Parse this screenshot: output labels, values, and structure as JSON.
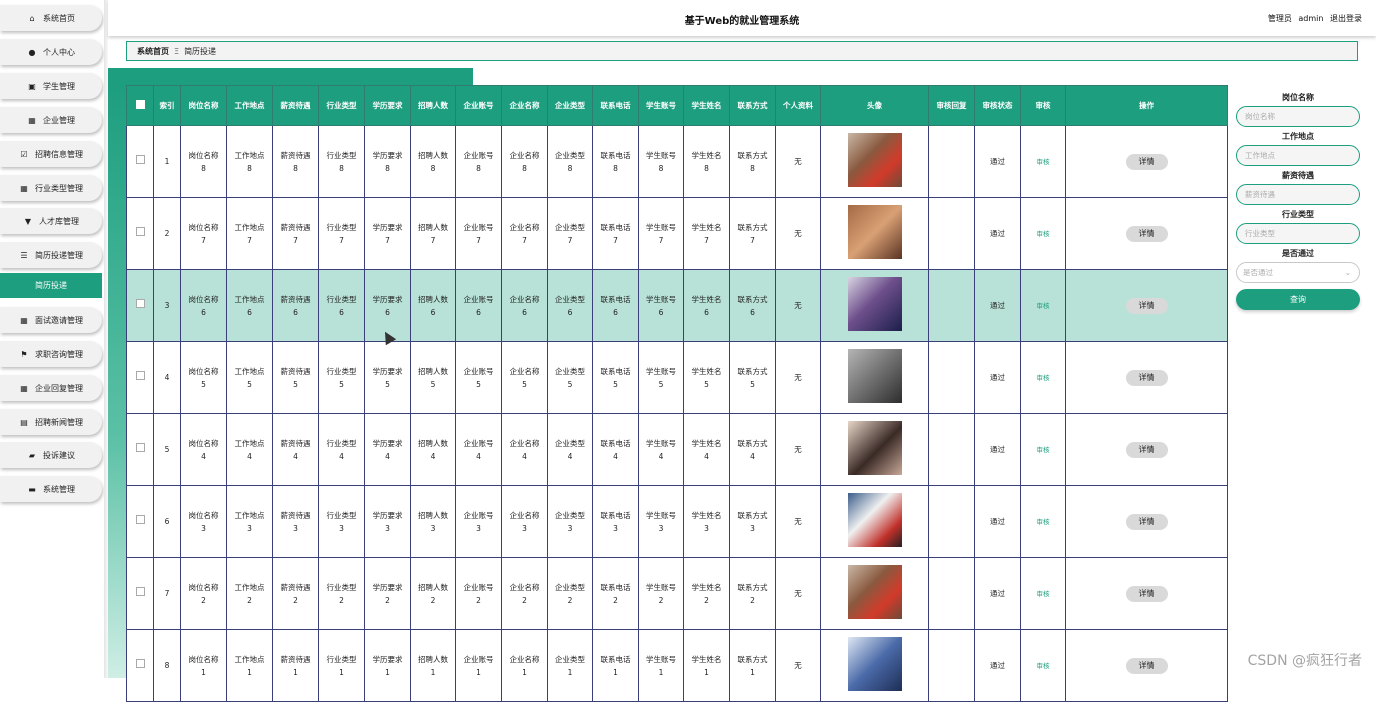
{
  "app": {
    "title": "基于Web的就业管理系统"
  },
  "header": {
    "role": "管理员",
    "username": "admin",
    "logout": "退出登录"
  },
  "sidebar": {
    "items": [
      {
        "label": "系统首页",
        "icon": "home-icon"
      },
      {
        "label": "个人中心",
        "icon": "user-icon"
      },
      {
        "label": "学生管理",
        "icon": "clipboard-icon"
      },
      {
        "label": "企业管理",
        "icon": "grid-icon"
      },
      {
        "label": "招聘信息管理",
        "icon": "checkbox-icon"
      },
      {
        "label": "行业类型管理",
        "icon": "grid-icon"
      },
      {
        "label": "人才库管理",
        "icon": "pin-icon"
      },
      {
        "label": "简历投递管理",
        "icon": "list-icon"
      },
      {
        "label": "简历投递",
        "icon": "",
        "active": true
      },
      {
        "label": "面试邀请管理",
        "icon": "grid-icon"
      },
      {
        "label": "求职咨询管理",
        "icon": "flag-icon"
      },
      {
        "label": "企业回复管理",
        "icon": "grid-icon"
      },
      {
        "label": "招聘新闻管理",
        "icon": "newspaper-icon"
      },
      {
        "label": "投诉建议",
        "icon": "chat-icon"
      },
      {
        "label": "系统管理",
        "icon": "database-icon"
      }
    ]
  },
  "breadcrumb": {
    "home": "系统首页",
    "separator": "Ξ",
    "current": "简历投递"
  },
  "table": {
    "columns": [
      "",
      "索引",
      "岗位名称",
      "工作地点",
      "薪资待遇",
      "行业类型",
      "学历要求",
      "招聘人数",
      "企业账号",
      "企业名称",
      "企业类型",
      "联系电话",
      "学生账号",
      "学生姓名",
      "联系方式",
      "个人资料",
      "头像",
      "审核回复",
      "审核状态",
      "审核",
      "操作"
    ],
    "rows": [
      {
        "index": "1",
        "n": "8",
        "resume": "无",
        "status": "通过",
        "audit": "审核",
        "action": "详情"
      },
      {
        "index": "2",
        "n": "7",
        "resume": "无",
        "status": "通过",
        "audit": "审核",
        "action": "详情"
      },
      {
        "index": "3",
        "n": "6",
        "resume": "无",
        "status": "通过",
        "audit": "审核",
        "action": "详情"
      },
      {
        "index": "4",
        "n": "5",
        "resume": "无",
        "status": "通过",
        "audit": "审核",
        "action": "详情"
      },
      {
        "index": "5",
        "n": "4",
        "resume": "无",
        "status": "通过",
        "audit": "审核",
        "action": "详情"
      },
      {
        "index": "6",
        "n": "3",
        "resume": "无",
        "status": "通过",
        "audit": "审核",
        "action": "详情"
      },
      {
        "index": "7",
        "n": "2",
        "resume": "无",
        "status": "通过",
        "audit": "审核",
        "action": "详情"
      },
      {
        "index": "8",
        "n": "1",
        "resume": "无",
        "status": "通过",
        "audit": "审核",
        "action": "详情"
      }
    ]
  },
  "search": {
    "fields": [
      {
        "label": "岗位名称",
        "placeholder": "岗位名称"
      },
      {
        "label": "工作地点",
        "placeholder": "工作地点"
      },
      {
        "label": "薪资待遇",
        "placeholder": "薪资待遇"
      },
      {
        "label": "行业类型",
        "placeholder": "行业类型"
      }
    ],
    "select_label": "是否通过",
    "select_placeholder": "是否通过",
    "button": "查询"
  },
  "watermark": "CSDN @疯狂行者",
  "colors": {
    "accent": "#1d9e7f",
    "selected_row": "#b8e2d7"
  }
}
